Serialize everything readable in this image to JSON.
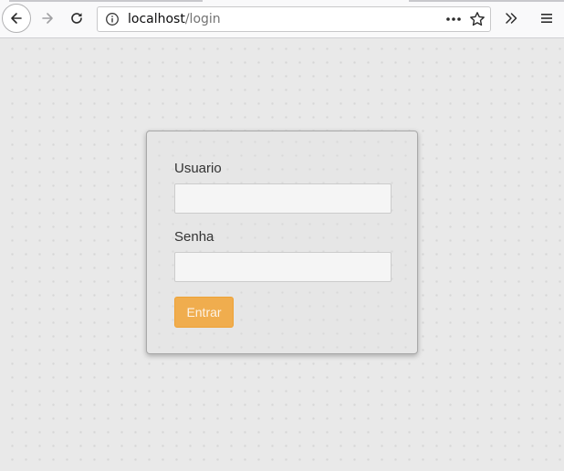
{
  "browser": {
    "url_host": "localhost",
    "url_path": "/login",
    "icons": {
      "back": "back-arrow-icon",
      "forward": "forward-arrow-icon",
      "reload": "reload-icon",
      "info": "info-icon",
      "page_actions": "more-horizontal-icon",
      "bookmark": "star-icon",
      "overflow": "chevron-double-right-icon",
      "menu": "hamburger-menu-icon"
    }
  },
  "login_form": {
    "username_label": "Usuario",
    "username_value": "",
    "password_label": "Senha",
    "password_value": "",
    "submit_label": "Entrar"
  },
  "colors": {
    "page_background": "#e9e9e9",
    "card_background": "#e6e6e6",
    "button_warning": "#f0ad4e",
    "button_text": "#fdf3e6",
    "label_text": "#333333"
  }
}
